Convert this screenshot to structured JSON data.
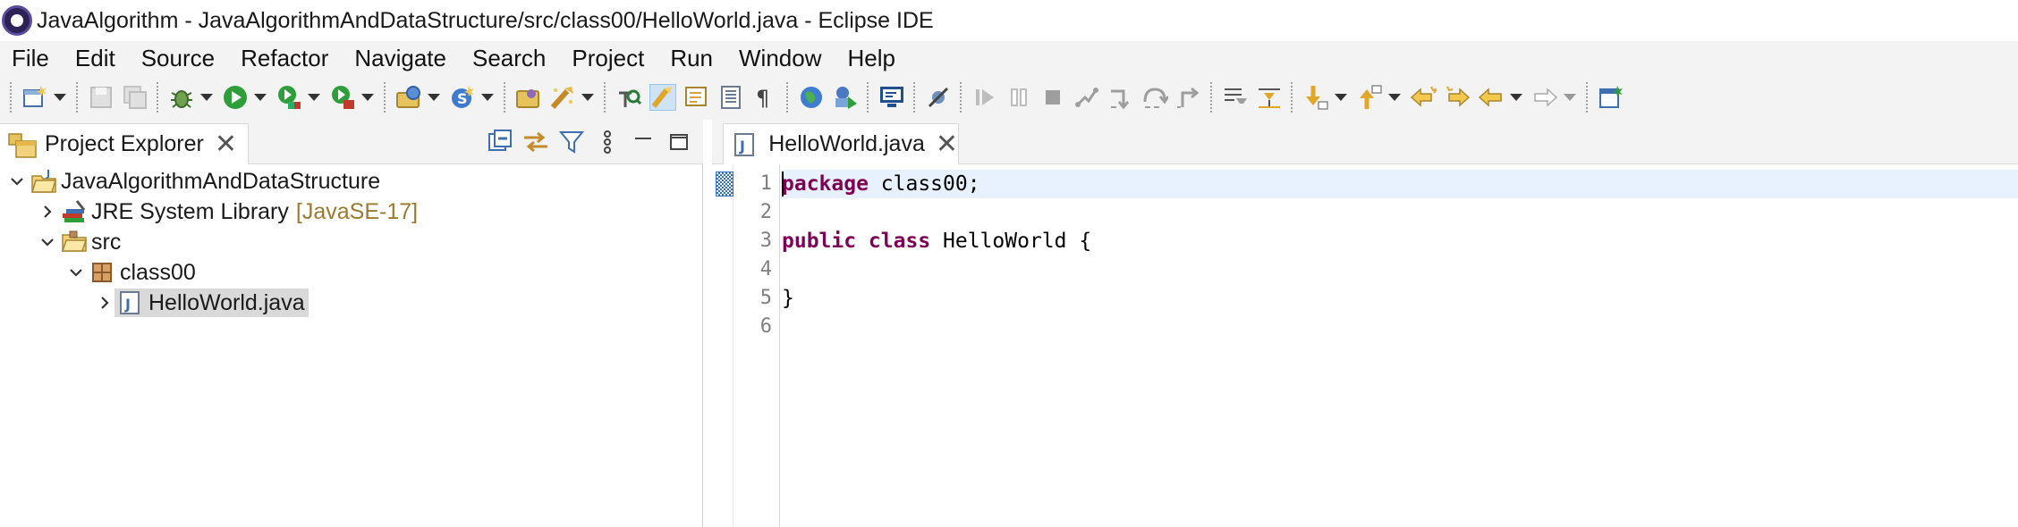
{
  "window": {
    "title": "JavaAlgorithm - JavaAlgorithmAndDataStructure/src/class00/HelloWorld.java - Eclipse IDE"
  },
  "menubar": {
    "items": [
      "File",
      "Edit",
      "Source",
      "Refactor",
      "Navigate",
      "Search",
      "Project",
      "Run",
      "Window",
      "Help"
    ]
  },
  "toolbar": {
    "icons": [
      "new-wizard-icon",
      "save-icon",
      "save-all-icon",
      "debug-icon",
      "run-icon",
      "coverage-icon",
      "external-tools-icon",
      "new-java-project-icon",
      "new-java-class-icon",
      "open-type-icon",
      "search-icon",
      "toggle-breadcrumb-icon",
      "toggle-mark-occurrences-icon",
      "toggle-block-selection-icon",
      "show-whitespace-icon",
      "web-browser-icon",
      "open-task-icon",
      "console-icon",
      "skip-breakpoints-icon",
      "resume-icon",
      "suspend-icon",
      "terminate-icon",
      "disconnect-icon",
      "step-into-icon",
      "step-over-icon",
      "step-return-icon",
      "drop-to-frame-icon",
      "use-step-filters-icon",
      "next-annotation-icon",
      "previous-annotation-icon",
      "last-edit-location-icon",
      "back-icon",
      "forward-icon",
      "open-perspective-icon"
    ]
  },
  "project_explorer": {
    "tab_label": "Project Explorer",
    "tree": [
      {
        "label": "JavaAlgorithmAndDataStructure",
        "decoration": "",
        "icon": "java-project-icon",
        "expanded": true,
        "level": 0
      },
      {
        "label": "JRE System Library",
        "decoration": "[JavaSE-17]",
        "icon": "library-icon",
        "expanded": false,
        "level": 1
      },
      {
        "label": "src",
        "decoration": "",
        "icon": "source-folder-icon",
        "expanded": true,
        "level": 1
      },
      {
        "label": "class00",
        "decoration": "",
        "icon": "package-icon",
        "expanded": true,
        "level": 2
      },
      {
        "label": "HelloWorld.java",
        "decoration": "",
        "icon": "java-file-icon",
        "expanded": false,
        "level": 3,
        "selected": true
      }
    ]
  },
  "editor": {
    "tab_label": "HelloWorld.java",
    "line_numbers": [
      "1",
      "2",
      "3",
      "4",
      "5",
      "6"
    ],
    "lines": [
      {
        "kw": "package",
        "rest": " class00;"
      },
      {
        "kw": "",
        "rest": ""
      },
      {
        "kw": "public class",
        "rest": " HelloWorld {"
      },
      {
        "kw": "",
        "rest": ""
      },
      {
        "kw": "",
        "rest": "}"
      },
      {
        "kw": "",
        "rest": ""
      }
    ]
  },
  "colors": {
    "keyword": "#7f0055",
    "current_line": "#e8f2fe",
    "decoration": "#9b7a2f",
    "chrome": "#f3f3f3"
  }
}
